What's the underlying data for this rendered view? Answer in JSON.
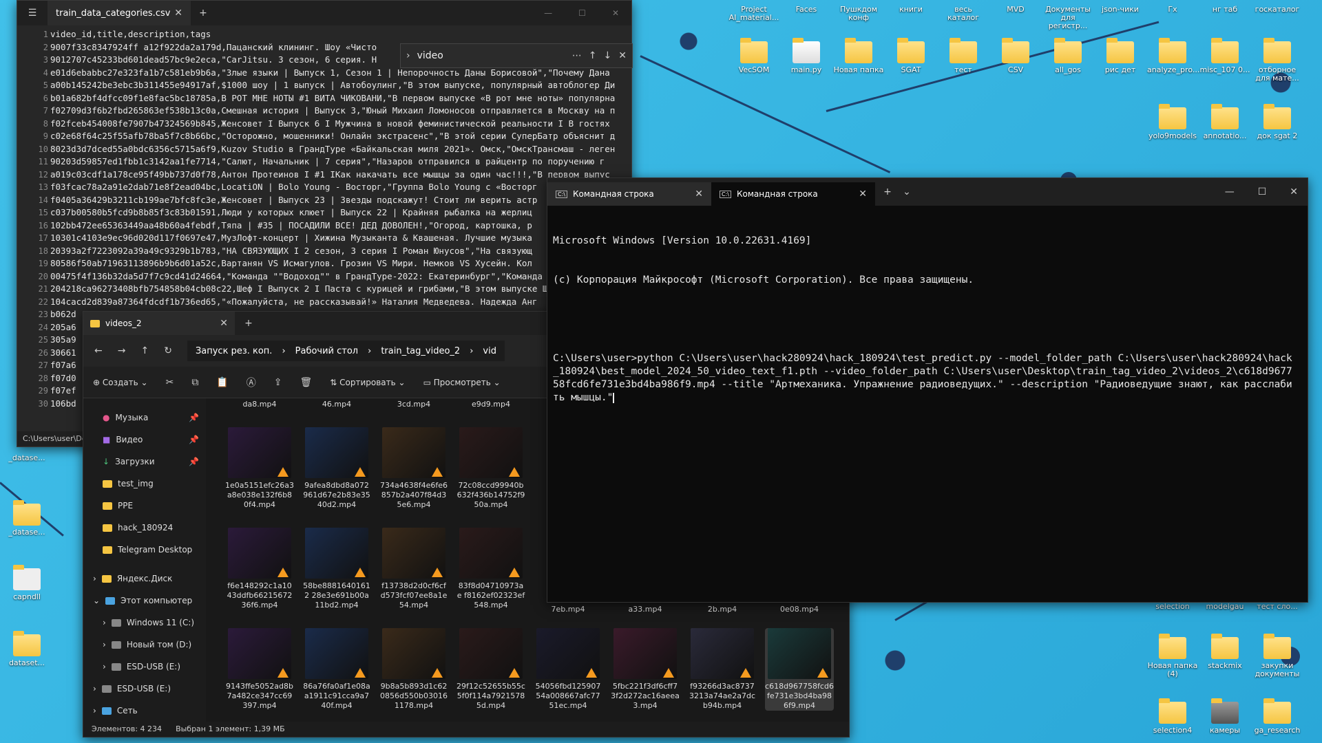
{
  "notepad": {
    "tab_title": "train_data_categories.csv",
    "find_query": "video",
    "status_path": "C:\\Users\\user\\De",
    "lines": [
      "video_id,title,description,tags",
      "9007f33c8347924ff a12f922da2a179d,Пацанский клининг. Шоу «Чисто",
      "9012707c45233bd601dead57bc9e2eca,\"CarJitsu. 3 сезон, 6 серия. Н",
      "e01d6ebabbc27e323fa1b7c581eb9b6a,\"Злые языки | Выпуск 1, Сезон 1 | Непорочность Даны Борисовой\",\"Почему Дана",
      "a00b145242be3ebc3b311455e94917af,$1000 шоу | 1 выпуск | Автобоулинг,\"В этом выпуске, популярный автоблогер Ди",
      "b01a682bf4dfcc09f1e8fac5bc18785a,В РОТ МНЕ НОТЫ #1 ВИТА ЧИКОВАНИ,\"В первом выпуске «В рот мне ноты» популярна",
      "f02709d3f6b2fbd265863ef538b13c0a,Смешная история | Выпуск 3,\"Юный Михаил Ломоносов отправляется в Москву на п",
      "f02fceb454008fe7907b47324569b845,Женсовет I Выпуск 6 I Мужчина в новой феминистической реальности I В гостях",
      "c02e68f64c25f55afb78ba5f7c8b66bc,\"Осторожно, мошенники! Онлайн экстрасенс\",\"В этой серии СуперБатр объяснит д",
      "8023d3d7dced55a0bdc6356c5715a6f9,Kuzov Studio в ГрандТуре «Байкальская миля 2021». Омск,\"ОмскТрансмаш - леген",
      "90203d59857ed1fbb1c3142aa1fe7714,\"Салют, Начальник | 7 серия\",\"Назаров отправился в райцентр по поручению г",
      "a019c03cdf1a178ce95f49bb737d0f78,Антон Протеинов I #1 IКак накачать все мышцы за один час!!!,\"В первом выпус",
      "f03fcac78a2a91e2dab71e8f2ead04bc,LocatiON | Bolo Young - Восторг,\"Группа Bolo Young с «Восторг",
      "f0405a36429b3211cb199ae7bfc8fc3e,Женсовет | Выпуск 23 | Звезды подскажут! Стоит ли верить астр",
      "c037b00580b5fcd9b8b85f3c83b01591,Люди у которых клюет | Выпуск 22 | Крайняя рыбалка на жерлиц",
      "102bb472ee65363449aa48b60a4febdf,Тяпа | #35 | ПОСАДИЛИ ВСЕ! ДЕД ДОВОЛЕН!,\"Огород, картошка, р",
      "10301c4103e9ec96d020d117f0697e47,МузЛофт-концерт | Хижина Музыканта & Квашеная. Лучшие музыка",
      "20393a2f7223092a39a49c9329b1b783,\"НА СВЯЗУЮЩИХ I 2 сезон, 3 серия I Роман Юнусов\",\"На связующ",
      "80586f50ab71963113896b9b6d01a52c,Вартанян VS Исмагулов. Грозин VS Мири. Немков VS Хусейн. Кол",
      "00475f4f136b32da5d7f7c9cd41d24664,\"Команда \"\"Водоход\"\" в ГрандТуре-2022: Екатеринбург\",\"Команда",
      "204218ca96273408bfb754858b04cb08c22,Шеф I Выпуск 2 I Паста с курицей и грибами,\"В этом выпуске Ше",
      "104cacd2d839a87364fdcdf1b736ed65,\"«Пожалуйста, не рассказывай!» Наталия Медведева. Надежда Анг",
      "b062d",
      "205a6",
      "305a9",
      "30661",
      "f07a6",
      "f07d0",
      "f07ef",
      "106bd"
    ]
  },
  "explorer": {
    "tab_title": "videos_2",
    "breadcrumbs": [
      "Запуск рез. коп.",
      "Рабочий стол",
      "train_tag_video_2",
      "vid"
    ],
    "commands": {
      "create": "Создать",
      "sort": "Сортировать",
      "view": "Просмотреть"
    },
    "nav": [
      {
        "label": "Музыка",
        "icon": "music-icon",
        "pinned": true
      },
      {
        "label": "Видео",
        "icon": "video-icon",
        "pinned": true
      },
      {
        "label": "Загрузки",
        "icon": "download-icon",
        "pinned": true
      },
      {
        "label": "test_img",
        "icon": "folder-icon",
        "pinned": false
      },
      {
        "label": "PPE",
        "icon": "folder-icon",
        "pinned": false
      },
      {
        "label": "hack_180924",
        "icon": "folder-icon",
        "pinned": false
      },
      {
        "label": "Telegram Desktop",
        "icon": "folder-icon",
        "pinned": false
      },
      {
        "label": "Яндекс.Диск",
        "icon": "cloud-icon",
        "pinned": false
      },
      {
        "label": "Этот компьютер",
        "icon": "computer-icon",
        "pinned": false
      },
      {
        "label": "Windows 11 (C:)",
        "icon": "drive-icon",
        "pinned": false
      },
      {
        "label": "Новый том (D:)",
        "icon": "drive-icon",
        "pinned": false
      },
      {
        "label": "ESD-USB (E:)",
        "icon": "drive-icon",
        "pinned": false
      },
      {
        "label": "ESD-USB (E:)",
        "icon": "usb-icon",
        "pinned": false
      },
      {
        "label": "Сеть",
        "icon": "network-icon",
        "pinned": false
      }
    ],
    "top_partial": [
      "da8.mp4",
      "46.mp4",
      "3cd.mp4",
      "e9d9.mp4"
    ],
    "row1": [
      "1e0a5151efc26a3a8e038e132f6b80f4.mp4",
      "9afea8dbd8a072961d67e2b83e3540d2.mp4",
      "734a4638f4e6fe6857b2a407f84d35e6.mp4",
      "72c08ccd99940b632f436b14752f950a.mp4"
    ],
    "row2": [
      "f6e148292c1a1043ddfb6621567236f6.mp4",
      "58be88816401612 28e3e691b00a11bd2.mp4",
      "f13738d2d0cf6cfd573fcf07ee8a1e54.mp4",
      "83f8d04710973ae f8162ef02323ef548.mp4"
    ],
    "row2_partial": [
      "7eb.mp4",
      "a33.mp4",
      "2b.mp4",
      "0e08.mp4"
    ],
    "row3": [
      "9143ffe5052ad8b7a482ce347cc69397.mp4",
      "86a76fa0af1e08aa1911c91cca9a740f.mp4",
      "9b8a5b893d1c620856d550b030161178.mp4",
      "29f12c52655b55c5f0f114a79215785d.mp4",
      "54056fbd12590754a008667afc7751ec.mp4",
      "5fbc221f3df6cff73f2d272ac16aeea3.mp4",
      "f93266d3ac87373213a74ae2a7dcb94b.mp4",
      "c618d967758fcd6fe731e3bd4ba986f9.mp4"
    ],
    "status": {
      "count": "Элементов: 4 234",
      "selected": "Выбран 1 элемент: 1,39 МБ"
    }
  },
  "terminal": {
    "tabs": [
      "Командная строка",
      "Командная строка"
    ],
    "line1": "Microsoft Windows [Version 10.0.22631.4169]",
    "line2": "(c) Корпорация Майкрософт (Microsoft Corporation). Все права защищены.",
    "command": "C:\\Users\\user>python C:\\Users\\user\\hack280924\\hack_180924\\test_predict.py --model_folder_path C:\\Users\\user\\hack280924\\hack_180924\\best_model_2024_50_video_text_f1.pth --video_folder_path C:\\Users\\user\\Desktop\\train_tag_video_2\\videos_2\\c618d967758fcd6fe731e3bd4ba986f9.mp4 --title \"Артмеханика. Упражнение радиоведущих.\" --description \"Радиоведущие знают, как расслабить мышцы.\""
  },
  "desktop": {
    "top_labels": [
      "Project AI_material...",
      "Faces",
      "Пушкдом конф",
      "книги",
      "весь каталог",
      "MVD",
      "Документы для регистр...",
      "json-чики",
      "Гх",
      "нг таб",
      "госкаталог"
    ],
    "row1": [
      "VecSOM",
      "main.py",
      "Новая папка",
      "SGAT",
      "тест",
      "CSV",
      "all_gos",
      "рис дет",
      "analyze_pro...",
      "misc_107 0...",
      "отборное для мате..."
    ],
    "row2": [
      "yolo9models",
      "annotatio...",
      "док sgat 2"
    ],
    "right_lower": [
      "Новая папка (4)",
      "stackmix",
      "закупки документы",
      "selection4",
      "камеры",
      "ga_research"
    ],
    "right_partial": [
      "selection",
      "modelgau",
      "тест сло..."
    ],
    "left": [
      "_datase...",
      "_datase...",
      "capndll",
      "dataset..."
    ]
  }
}
